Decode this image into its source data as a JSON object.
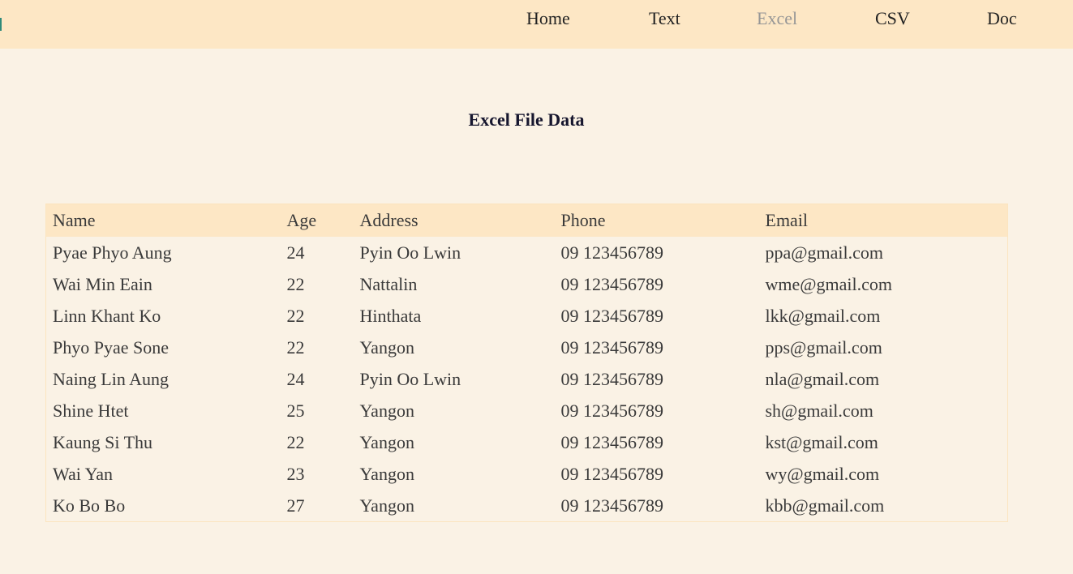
{
  "nav": {
    "items": [
      {
        "label": "Home",
        "active": false
      },
      {
        "label": "Text",
        "active": false
      },
      {
        "label": "Excel",
        "active": true
      },
      {
        "label": "CSV",
        "active": false
      },
      {
        "label": "Doc",
        "active": false
      }
    ]
  },
  "page": {
    "title": "Excel File Data"
  },
  "table": {
    "columns": [
      "Name",
      "Age",
      "Address",
      "Phone",
      "Email"
    ],
    "rows": [
      [
        "Pyae Phyo Aung",
        "24",
        "Pyin Oo Lwin",
        "09 123456789",
        "ppa@gmail.com"
      ],
      [
        "Wai Min Eain",
        "22",
        "Nattalin",
        "09 123456789",
        "wme@gmail.com"
      ],
      [
        "Linn Khant Ko",
        "22",
        "Hinthata",
        "09 123456789",
        "lkk@gmail.com"
      ],
      [
        "Phyo Pyae Sone",
        "22",
        "Yangon",
        "09 123456789",
        "pps@gmail.com"
      ],
      [
        "Naing Lin Aung",
        "24",
        "Pyin Oo Lwin",
        "09 123456789",
        "nla@gmail.com"
      ],
      [
        "Shine Htet",
        "25",
        "Yangon",
        "09 123456789",
        "sh@gmail.com"
      ],
      [
        "Kaung Si Thu",
        "22",
        "Yangon",
        "09 123456789",
        "kst@gmail.com"
      ],
      [
        "Wai Yan",
        "23",
        "Yangon",
        "09 123456789",
        "wy@gmail.com"
      ],
      [
        "Ko Bo Bo",
        "27",
        "Yangon",
        "09 123456789",
        "kbb@gmail.com"
      ]
    ]
  },
  "colors": {
    "page_background": "#faf2e5",
    "navbar_background": "#fde7c5",
    "table_header_background": "#fde7c5",
    "active_nav_text": "#969696",
    "nav_text": "#222222",
    "title_text": "#16162e"
  }
}
